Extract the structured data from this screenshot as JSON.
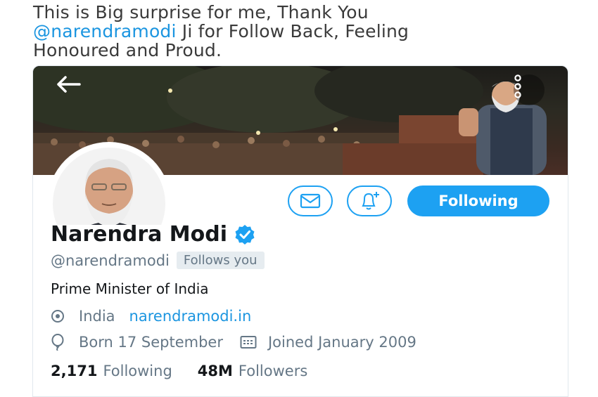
{
  "tweet": {
    "line1": "This is Big surprise for me, Thank You",
    "mention": "@narendramodi",
    "line2_rest": " Ji for Follow Back, Feeling",
    "line3": "Honoured and Proud."
  },
  "profile": {
    "display_name": "Narendra Modi",
    "handle": "@narendramodi",
    "follows_you": "Follows you",
    "bio": "Prime Minister of India",
    "location": "India",
    "website": "narendramodi.in",
    "born": "Born 17 September",
    "joined": "Joined January 2009",
    "following_count": "2,171",
    "following_label": "Following",
    "followers_count": "48M",
    "followers_label": "Followers"
  },
  "actions": {
    "follow_label": "Following",
    "message_icon": "envelope-icon",
    "notify_icon": "bell-plus-icon"
  },
  "colors": {
    "accent": "#1da1f2",
    "link": "#1b95e0",
    "secondary_text": "#657786"
  }
}
